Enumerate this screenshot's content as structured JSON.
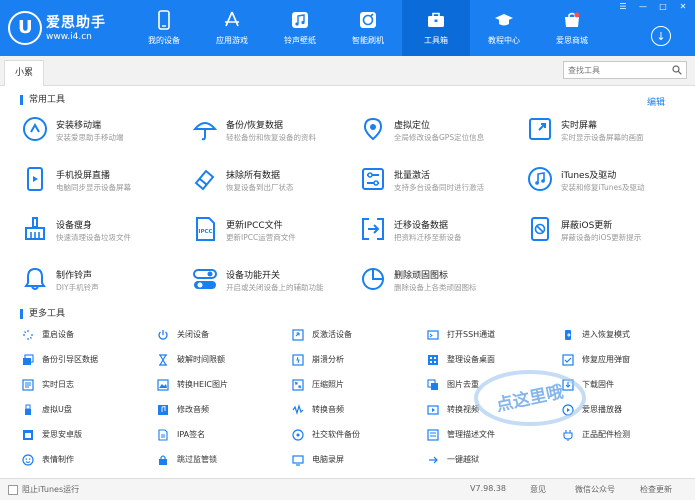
{
  "app": {
    "logo_char": "U",
    "title": "爱思助手",
    "url": "www.i4.cn"
  },
  "nav": [
    {
      "label": "我的设备",
      "icon": "phone-icon"
    },
    {
      "label": "应用游戏",
      "icon": "app-store-icon"
    },
    {
      "label": "铃声壁纸",
      "icon": "music-icon"
    },
    {
      "label": "智能刷机",
      "icon": "flash-icon"
    },
    {
      "label": "工具箱",
      "icon": "toolbox-icon"
    },
    {
      "label": "教程中心",
      "icon": "graduation-icon"
    },
    {
      "label": "爱思商城",
      "icon": "shop-icon"
    }
  ],
  "window": {
    "menu": "☰",
    "minimize": "—",
    "maximize": "□",
    "close": "✕",
    "download": "↓"
  },
  "tab": {
    "label": "小累"
  },
  "search": {
    "placeholder": "查找工具"
  },
  "common": {
    "title": "常用工具",
    "edit": "编辑",
    "tools": [
      {
        "name": "安装移动端",
        "desc": "安装爱思助手移动端",
        "icon": "install-icon"
      },
      {
        "name": "备份/恢复数据",
        "desc": "轻松备份和恢复设备的资料",
        "icon": "umbrella-icon"
      },
      {
        "name": "虚拟定位",
        "desc": "全局修改设备GPS定位信息",
        "icon": "location-icon"
      },
      {
        "name": "实时屏幕",
        "desc": "实时显示设备屏幕的画面",
        "icon": "screen-icon"
      },
      {
        "name": "手机投屏直播",
        "desc": "电脑同步显示设备屏幕",
        "icon": "cast-icon"
      },
      {
        "name": "抹除所有数据",
        "desc": "恢复设备到出厂状态",
        "icon": "eraser-icon"
      },
      {
        "name": "批量激活",
        "desc": "支持多台设备同时进行激活",
        "icon": "batch-icon"
      },
      {
        "name": "iTunes及驱动",
        "desc": "安装和修复iTunes及驱动",
        "icon": "itunes-icon"
      },
      {
        "name": "设备瘦身",
        "desc": "快速清理设备垃圾文件",
        "icon": "broom-icon"
      },
      {
        "name": "更新IPCC文件",
        "desc": "更新IPCC运营商文件",
        "icon": "ipcc-icon"
      },
      {
        "name": "迁移设备数据",
        "desc": "把资料迁移至新设备",
        "icon": "migrate-icon"
      },
      {
        "name": "屏蔽iOS更新",
        "desc": "屏蔽设备的iOS更新提示",
        "icon": "block-update-icon"
      },
      {
        "name": "制作铃声",
        "desc": "DIY手机铃声",
        "icon": "bell-icon"
      },
      {
        "name": "设备功能开关",
        "desc": "开启或关闭设备上的辅助功能",
        "icon": "toggle-icon"
      },
      {
        "name": "删除顽固图标",
        "desc": "删除设备上各类顽固图标",
        "icon": "pie-icon"
      }
    ]
  },
  "more": {
    "title": "更多工具",
    "tools": [
      {
        "name": "重启设备",
        "icon": "restart-icon"
      },
      {
        "name": "关闭设备",
        "icon": "power-icon"
      },
      {
        "name": "反激活设备",
        "icon": "deactivate-icon"
      },
      {
        "name": "打开SSH通道",
        "icon": "ssh-icon"
      },
      {
        "name": "进入恢复模式",
        "icon": "recovery-icon"
      },
      {
        "name": "备份引导区数据",
        "icon": "backup-boot-icon"
      },
      {
        "name": "破解时间限额",
        "icon": "hourglass-icon"
      },
      {
        "name": "崩溃分析",
        "icon": "crash-icon"
      },
      {
        "name": "整理设备桌面",
        "icon": "desktop-icon"
      },
      {
        "name": "修复应用弹窗",
        "icon": "fix-popup-icon"
      },
      {
        "name": "实时日志",
        "icon": "log-icon"
      },
      {
        "name": "转换HEIC图片",
        "icon": "heic-icon"
      },
      {
        "name": "压缩照片",
        "icon": "compress-icon"
      },
      {
        "name": "图片去重",
        "icon": "dedupe-icon"
      },
      {
        "name": "下载固件",
        "icon": "firmware-icon"
      },
      {
        "name": "虚拟U盘",
        "icon": "usb-icon"
      },
      {
        "name": "修改音频",
        "icon": "audio-edit-icon"
      },
      {
        "name": "转换音频",
        "icon": "audio-convert-icon"
      },
      {
        "name": "转换视频",
        "icon": "video-convert-icon"
      },
      {
        "name": "爱思播放器",
        "icon": "player-icon"
      },
      {
        "name": "爱思安卓版",
        "icon": "android-icon"
      },
      {
        "name": "IPA签名",
        "icon": "ipa-icon"
      },
      {
        "name": "社交软件备份",
        "icon": "social-icon"
      },
      {
        "name": "管理描述文件",
        "icon": "profile-icon"
      },
      {
        "name": "正品配件检测",
        "icon": "accessory-icon"
      },
      {
        "name": "表情制作",
        "icon": "emoji-icon"
      },
      {
        "name": "跳过监管锁",
        "icon": "lock-icon"
      },
      {
        "name": "电脑录屏",
        "icon": "record-icon"
      },
      {
        "name": "一键越狱",
        "icon": "jailbreak-icon"
      }
    ]
  },
  "watermark": {
    "text": "点这里哦"
  },
  "footer": {
    "itunes_label": "阻止iTunes运行",
    "version": "V7.98.38",
    "feedback": "意见",
    "wechat": "微信公众号",
    "update": "检查更新"
  },
  "colors": {
    "primary": "#1a7ff0",
    "nav_active": "#0b6bd8",
    "icon": "#1a7ff0"
  }
}
